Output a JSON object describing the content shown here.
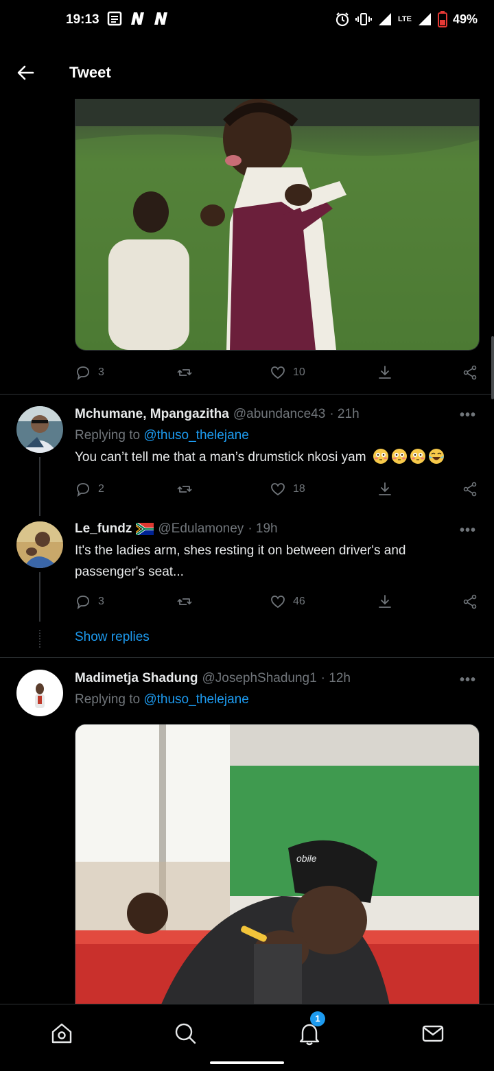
{
  "status_bar": {
    "time": "19:13",
    "battery": "49%",
    "network": "LTE",
    "icons": [
      "news-icon",
      "n-icon",
      "n-icon",
      "alarm-icon",
      "vibrate-icon",
      "signal-icon",
      "battery-icon"
    ]
  },
  "header": {
    "title": "Tweet"
  },
  "main_tweet": {
    "image_alt": "photo of girl in school uniform pointing",
    "actions": {
      "replies": "3",
      "likes": "10"
    }
  },
  "replies": [
    {
      "name": "Mchumane, Mpangazitha",
      "handle": "@abundance43",
      "time": "· 21h",
      "replying_prefix": "Replying to",
      "replying_to": "@thuso_thelejane",
      "text": "You can’t tell me that a man’s drumstick nkosi yam",
      "emojis": [
        "flushed",
        "flushed",
        "flushed",
        "joy"
      ],
      "actions": {
        "replies": "2",
        "likes": "18"
      }
    },
    {
      "name": "Le_fundz",
      "handle": "@Edulamoney",
      "time": "· 19h",
      "text": "It's the ladies arm, shes resting it on between driver's and passenger's seat...",
      "actions": {
        "replies": "3",
        "likes": "46"
      },
      "show_replies": "Show replies"
    },
    {
      "name": "Madimetja Shadung",
      "handle": "@JosephShadung1",
      "time": "· 12h",
      "replying_prefix": "Replying to",
      "replying_to": "@thuso_thelejane",
      "image_text": "obile"
    }
  ],
  "bottom_nav": {
    "notifications_badge": "1"
  },
  "colors": {
    "accent": "#1d9bf0",
    "background": "#000000",
    "muted": "#71767b"
  }
}
